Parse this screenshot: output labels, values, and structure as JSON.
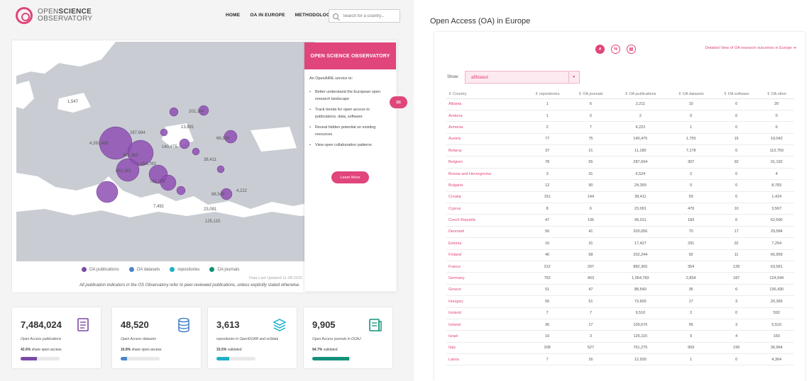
{
  "header": {
    "logo_open": "OPEN",
    "logo_science": "SCIENCE",
    "logo_observatory": "OBSERVATORY",
    "nav": [
      "HOME",
      "OA IN EUROPE",
      "METHODOLOGY"
    ],
    "search_placeholder": "Search for a country..."
  },
  "map": {
    "bubble_labels": [
      "1,547",
      "4,392,468",
      "482,365",
      "1,054,783",
      "882,365",
      "761,275",
      "140,475",
      "287,694",
      "202,244",
      "66,959",
      "4,222",
      "7,492",
      "88,549",
      "23,091",
      "125,115",
      "13,891",
      "38,411"
    ],
    "legend": [
      {
        "label": "OA publications",
        "color": "#7b4aa5"
      },
      {
        "label": "OA datasets",
        "color": "#4a84c7"
      },
      {
        "label": "repositories",
        "color": "#1cb0c5"
      },
      {
        "label": "OA journals",
        "color": "#11907a"
      }
    ],
    "updated": "Data Last Updated 11-08-2022",
    "disclaimer": "All publication indicators in the OS Observatory refer to peer-reviewed publications, unless explicitly stated otherwise."
  },
  "infobox": {
    "title": "OPEN SCIENCE OBSERVATORY",
    "intro": "An OpenAIRE service to:",
    "items": [
      "Better understand the European open research landscape",
      "Track trends for open access to publications, data, software",
      "Reveal hidden potential on existing resources",
      "View open collaboration patterns"
    ],
    "button": "Learn More"
  },
  "stats": [
    {
      "value": "7,484,024",
      "label": "Open Access publications",
      "share_pct": "42.6%",
      "share_text": "share open access",
      "fill": 0.426,
      "color": "#7b4aa5",
      "icon": "document-icon"
    },
    {
      "value": "48,520",
      "label": "Open Access datasets",
      "share_pct": "16.8%",
      "share_text": "share open access",
      "fill": 0.168,
      "color": "#4a84c7",
      "icon": "database-icon"
    },
    {
      "value": "3,613",
      "label": "repositories in OpenDOAR and re3data",
      "share_pct": "33.5%",
      "share_text": "validated",
      "fill": 0.335,
      "color": "#1cb0c5",
      "icon": "layers-icon"
    },
    {
      "value": "9,905",
      "label": "Open Access journals in DOAJ",
      "share_pct": "94.7%",
      "share_text": "validated",
      "fill": 0.947,
      "color": "#11907a",
      "icon": "journal-icon"
    }
  ],
  "table_panel": {
    "title": "Open Access (OA) in Europe",
    "detail_link": "Detailed View of OA research outcomes in Europe",
    "show_label": "Show:",
    "show_value": "affiliated",
    "columns": [
      "Country",
      "repositories",
      "OA journals",
      "OA publications",
      "OA datasets",
      "OA software",
      "OA other"
    ],
    "rows": [
      [
        "Albania",
        "1",
        "6",
        "2,211",
        "10",
        "0",
        "20"
      ],
      [
        "Andorra",
        "1",
        "0",
        "2",
        "0",
        "0",
        "0"
      ],
      [
        "Armenia",
        "2",
        "7",
        "4,222",
        "1",
        "0",
        "6"
      ],
      [
        "Austria",
        "77",
        "75",
        "140,475",
        "1,755",
        "15",
        "19,042"
      ],
      [
        "Belarus",
        "37",
        "21",
        "11,180",
        "7,178",
        "6",
        "113,759"
      ],
      [
        "Belgium",
        "78",
        "55",
        "287,694",
        "307",
        "92",
        "31,192"
      ],
      [
        "Bosnia and Herzegovina",
        "3",
        "31",
        "6,524",
        "2",
        "0",
        "4"
      ],
      [
        "Bulgaria",
        "12",
        "90",
        "24,359",
        "0",
        "0",
        "8,783"
      ],
      [
        "Croatia",
        "151",
        "144",
        "38,411",
        "59",
        "0",
        "1,424"
      ],
      [
        "Cyprus",
        "8",
        "6",
        "23,091",
        "479",
        "10",
        "3,567"
      ],
      [
        "Czech Republic",
        "47",
        "136",
        "96,011",
        "183",
        "6",
        "62,690"
      ],
      [
        "Denmark",
        "56",
        "41",
        "203,056",
        "70",
        "17",
        "29,584"
      ],
      [
        "Estonia",
        "16",
        "31",
        "17,427",
        "291",
        "32",
        "7,254"
      ],
      [
        "Finland",
        "40",
        "68",
        "202,244",
        "92",
        "11",
        "66,959"
      ],
      [
        "France",
        "312",
        "297",
        "882,365",
        "354",
        "128",
        "63,581"
      ],
      [
        "Germany",
        "752",
        "403",
        "1,054,783",
        "2,834",
        "187",
        "124,044"
      ],
      [
        "Greece",
        "51",
        "47",
        "88,549",
        "36",
        "6",
        "136,430"
      ],
      [
        "Hungary",
        "56",
        "51",
        "73,605",
        "17",
        "3",
        "20,365"
      ],
      [
        "Iceland",
        "7",
        "7",
        "9,516",
        "2",
        "0",
        "592"
      ],
      [
        "Ireland",
        "36",
        "17",
        "109,676",
        "95",
        "3",
        "5,510"
      ],
      [
        "Israel",
        "16",
        "3",
        "125,115",
        "9",
        "4",
        "160"
      ],
      [
        "Italy",
        "208",
        "527",
        "761,275",
        "959",
        "199",
        "36,964"
      ],
      [
        "Latvia",
        "7",
        "16",
        "12,930",
        "1",
        "0",
        "4,364"
      ]
    ]
  }
}
